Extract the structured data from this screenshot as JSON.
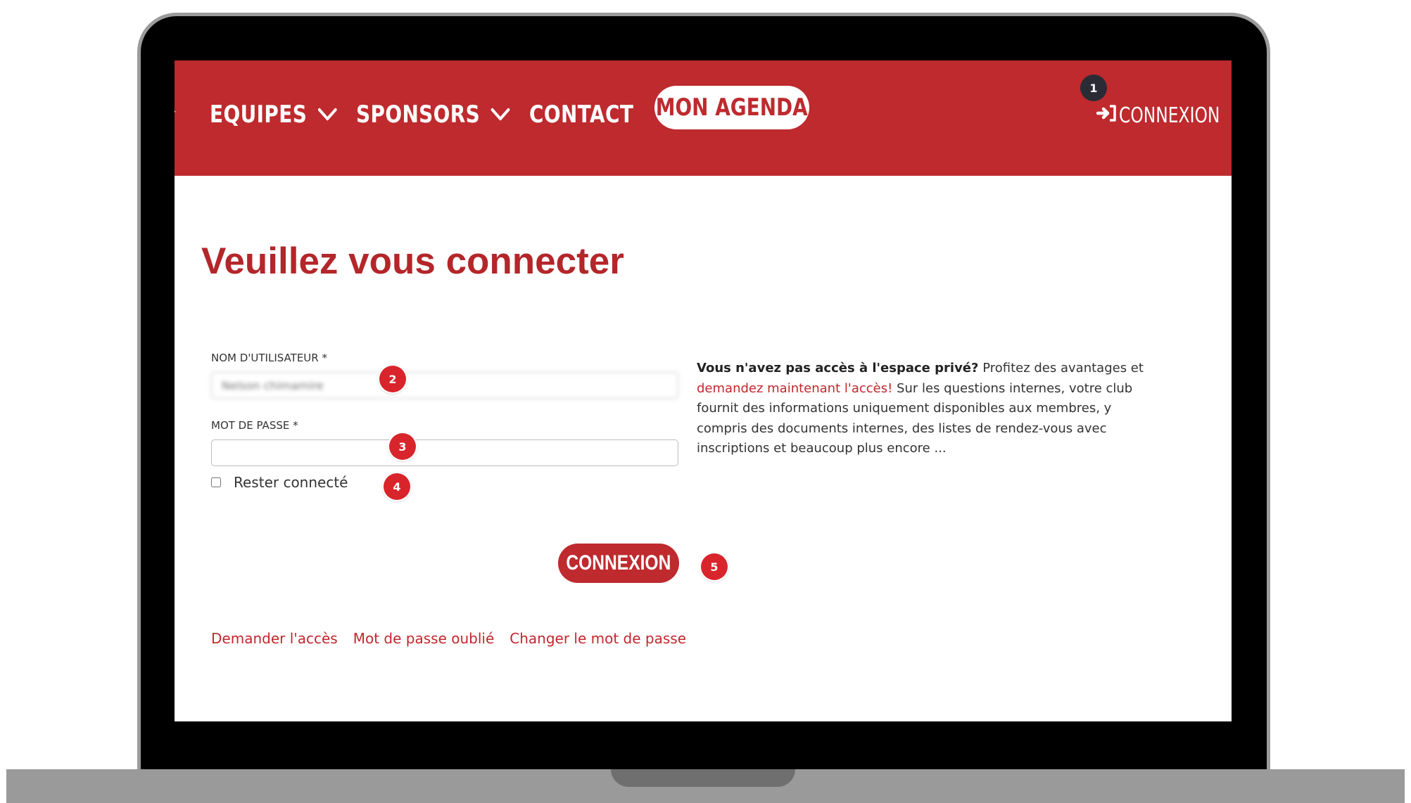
{
  "nav": {
    "items": [
      {
        "label": "EQUIPES",
        "has_dropdown": true
      },
      {
        "label": "SPONSORS",
        "has_dropdown": true
      },
      {
        "label": "CONTACT",
        "has_dropdown": false
      }
    ],
    "agenda_label": "MON AGENDA",
    "login_label": "CONNEXION",
    "login_icon": "sign-in-icon"
  },
  "page": {
    "title": "Veuillez vous connecter"
  },
  "form": {
    "username_label": "NOM D'UTILISATEUR *",
    "username_value": "Nelson chimamire",
    "password_label": "MOT DE PASSE *",
    "password_value": "",
    "remember_label": "Rester connecté",
    "remember_checked": false,
    "submit_label": "CONNEXION"
  },
  "info": {
    "bold": "Vous n'avez pas accès à l'espace privé?",
    "text1": " Profitez des avantages et ",
    "link": "demandez maintenant l'accès!",
    "text2": " Sur les questions internes, votre club fournit des informations uniquement disponibles aux membres, y compris des documents internes, des listes de rendez-vous avec inscriptions et beaucoup plus encore ..."
  },
  "links": {
    "request_access": "Demander l'accès",
    "forgot_password": "Mot de passe oublié",
    "change_password": "Changer le mot de passe"
  },
  "annotations": [
    "1",
    "2",
    "3",
    "4",
    "5"
  ],
  "colors": {
    "brand_red": "#be2a2e",
    "title_red": "#b3262a",
    "badge_red": "#d8252b",
    "badge_dark": "#2b2b35",
    "frame_gray": "#9a9a9a"
  }
}
